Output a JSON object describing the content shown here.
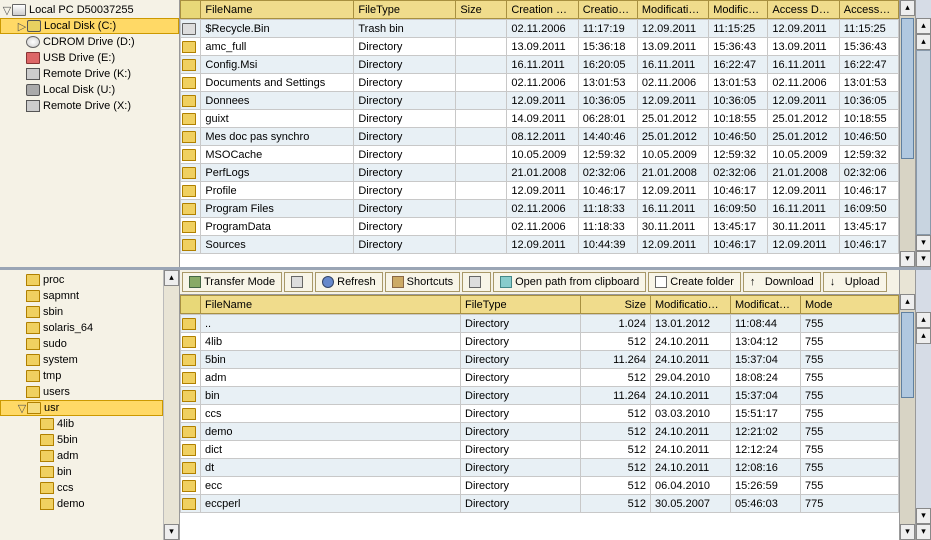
{
  "top_tree": {
    "root": "Local PC D50037255",
    "items": [
      {
        "label": "Local Disk (C:)",
        "icon": "disk-y",
        "selected": true,
        "indent": 1,
        "twist": "▷"
      },
      {
        "label": "CDROM Drive (D:)",
        "icon": "cd",
        "indent": 1
      },
      {
        "label": "USB Drive (E:)",
        "icon": "usb",
        "indent": 1
      },
      {
        "label": "Remote Drive (K:)",
        "icon": "net",
        "indent": 1
      },
      {
        "label": "Local Disk (U:)",
        "icon": "disk",
        "indent": 1
      },
      {
        "label": "Remote Drive (X:)",
        "icon": "net",
        "indent": 1
      }
    ]
  },
  "top_table": {
    "cols": [
      "FileName",
      "FileType",
      "Size",
      "Creation …",
      "Creatio…",
      "Modificati…",
      "Modific…",
      "Access D…",
      "Access…"
    ],
    "rows": [
      {
        "icon": "bin",
        "name": "$Recycle.Bin",
        "type": "Trash bin",
        "size": "",
        "cd": "02.11.2006",
        "ct": "11:17:19",
        "md": "12.09.2011",
        "mt": "11:15:25",
        "ad": "12.09.2011",
        "at": "11:15:25"
      },
      {
        "icon": "folder",
        "name": "amc_full",
        "type": "Directory",
        "size": "",
        "cd": "13.09.2011",
        "ct": "15:36:18",
        "md": "13.09.2011",
        "mt": "15:36:43",
        "ad": "13.09.2011",
        "at": "15:36:43"
      },
      {
        "icon": "folder",
        "name": "Config.Msi",
        "type": "Directory",
        "size": "",
        "cd": "16.11.2011",
        "ct": "16:20:05",
        "md": "16.11.2011",
        "mt": "16:22:47",
        "ad": "16.11.2011",
        "at": "16:22:47"
      },
      {
        "icon": "folder",
        "name": "Documents and Settings",
        "type": "Directory",
        "size": "",
        "cd": "02.11.2006",
        "ct": "13:01:53",
        "md": "02.11.2006",
        "mt": "13:01:53",
        "ad": "02.11.2006",
        "at": "13:01:53"
      },
      {
        "icon": "folder",
        "name": "Donnees",
        "type": "Directory",
        "size": "",
        "cd": "12.09.2011",
        "ct": "10:36:05",
        "md": "12.09.2011",
        "mt": "10:36:05",
        "ad": "12.09.2011",
        "at": "10:36:05"
      },
      {
        "icon": "folder",
        "name": "guixt",
        "type": "Directory",
        "size": "",
        "cd": "14.09.2011",
        "ct": "06:28:01",
        "md": "25.01.2012",
        "mt": "10:18:55",
        "ad": "25.01.2012",
        "at": "10:18:55"
      },
      {
        "icon": "folder",
        "name": "Mes doc pas synchro",
        "type": "Directory",
        "size": "",
        "cd": "08.12.2011",
        "ct": "14:40:46",
        "md": "25.01.2012",
        "mt": "10:46:50",
        "ad": "25.01.2012",
        "at": "10:46:50"
      },
      {
        "icon": "folder",
        "name": "MSOCache",
        "type": "Directory",
        "size": "",
        "cd": "10.05.2009",
        "ct": "12:59:32",
        "md": "10.05.2009",
        "mt": "12:59:32",
        "ad": "10.05.2009",
        "at": "12:59:32"
      },
      {
        "icon": "folder",
        "name": "PerfLogs",
        "type": "Directory",
        "size": "",
        "cd": "21.01.2008",
        "ct": "02:32:06",
        "md": "21.01.2008",
        "mt": "02:32:06",
        "ad": "21.01.2008",
        "at": "02:32:06"
      },
      {
        "icon": "folder",
        "name": "Profile",
        "type": "Directory",
        "size": "",
        "cd": "12.09.2011",
        "ct": "10:46:17",
        "md": "12.09.2011",
        "mt": "10:46:17",
        "ad": "12.09.2011",
        "at": "10:46:17"
      },
      {
        "icon": "folder",
        "name": "Program Files",
        "type": "Directory",
        "size": "",
        "cd": "02.11.2006",
        "ct": "11:18:33",
        "md": "16.11.2011",
        "mt": "16:09:50",
        "ad": "16.11.2011",
        "at": "16:09:50"
      },
      {
        "icon": "folder",
        "name": "ProgramData",
        "type": "Directory",
        "size": "",
        "cd": "02.11.2006",
        "ct": "11:18:33",
        "md": "30.11.2011",
        "mt": "13:45:17",
        "ad": "30.11.2011",
        "at": "13:45:17"
      },
      {
        "icon": "folder",
        "name": "Sources",
        "type": "Directory",
        "size": "",
        "cd": "12.09.2011",
        "ct": "10:44:39",
        "md": "12.09.2011",
        "mt": "10:46:17",
        "ad": "12.09.2011",
        "at": "10:46:17"
      }
    ]
  },
  "bottom_tree": {
    "items": [
      {
        "label": "proc",
        "icon": "folder",
        "indent": 1
      },
      {
        "label": "sapmnt",
        "icon": "folder",
        "indent": 1
      },
      {
        "label": "sbin",
        "icon": "folder",
        "indent": 1
      },
      {
        "label": "solaris_64",
        "icon": "folder",
        "indent": 1
      },
      {
        "label": "sudo",
        "icon": "folder",
        "indent": 1
      },
      {
        "label": "system",
        "icon": "folder",
        "indent": 1
      },
      {
        "label": "tmp",
        "icon": "folder",
        "indent": 1
      },
      {
        "label": "users",
        "icon": "folder",
        "indent": 1
      },
      {
        "label": "usr",
        "icon": "folder-open",
        "indent": 1,
        "twist": "▽",
        "selected": true
      },
      {
        "label": "4lib",
        "icon": "folder",
        "indent": 2
      },
      {
        "label": "5bin",
        "icon": "folder",
        "indent": 2
      },
      {
        "label": "adm",
        "icon": "folder",
        "indent": 2
      },
      {
        "label": "bin",
        "icon": "folder",
        "indent": 2
      },
      {
        "label": "ccs",
        "icon": "folder",
        "indent": 2
      },
      {
        "label": "demo",
        "icon": "folder",
        "indent": 2
      }
    ]
  },
  "toolbar": {
    "transfer": "Transfer Mode",
    "refresh": "Refresh",
    "shortcuts": "Shortcuts",
    "open": "Open path from clipboard",
    "create": "Create folder",
    "download": "Download",
    "upload": "Upload"
  },
  "bottom_table": {
    "cols": [
      "FileName",
      "FileType",
      "Size",
      "Modificatio…",
      "Modificat…",
      "Mode"
    ],
    "rows": [
      {
        "icon": "folder",
        "name": "..",
        "type": "Directory",
        "size": "1.024",
        "md": "13.01.2012",
        "mt": "11:08:44",
        "mode": "755"
      },
      {
        "icon": "folder",
        "name": "4lib",
        "type": "Directory",
        "size": "512",
        "md": "24.10.2011",
        "mt": "13:04:12",
        "mode": "755"
      },
      {
        "icon": "folder",
        "name": "5bin",
        "type": "Directory",
        "size": "11.264",
        "md": "24.10.2011",
        "mt": "15:37:04",
        "mode": "755"
      },
      {
        "icon": "folder",
        "name": "adm",
        "type": "Directory",
        "size": "512",
        "md": "29.04.2010",
        "mt": "18:08:24",
        "mode": "755"
      },
      {
        "icon": "folder",
        "name": "bin",
        "type": "Directory",
        "size": "11.264",
        "md": "24.10.2011",
        "mt": "15:37:04",
        "mode": "755"
      },
      {
        "icon": "folder",
        "name": "ccs",
        "type": "Directory",
        "size": "512",
        "md": "03.03.2010",
        "mt": "15:51:17",
        "mode": "755"
      },
      {
        "icon": "folder",
        "name": "demo",
        "type": "Directory",
        "size": "512",
        "md": "24.10.2011",
        "mt": "12:21:02",
        "mode": "755"
      },
      {
        "icon": "folder",
        "name": "dict",
        "type": "Directory",
        "size": "512",
        "md": "24.10.2011",
        "mt": "12:12:24",
        "mode": "755"
      },
      {
        "icon": "folder",
        "name": "dt",
        "type": "Directory",
        "size": "512",
        "md": "24.10.2011",
        "mt": "12:08:16",
        "mode": "755"
      },
      {
        "icon": "folder",
        "name": "ecc",
        "type": "Directory",
        "size": "512",
        "md": "06.04.2010",
        "mt": "15:26:59",
        "mode": "755"
      },
      {
        "icon": "folder",
        "name": "eccperl",
        "type": "Directory",
        "size": "512",
        "md": "30.05.2007",
        "mt": "05:46:03",
        "mode": "775"
      }
    ]
  }
}
